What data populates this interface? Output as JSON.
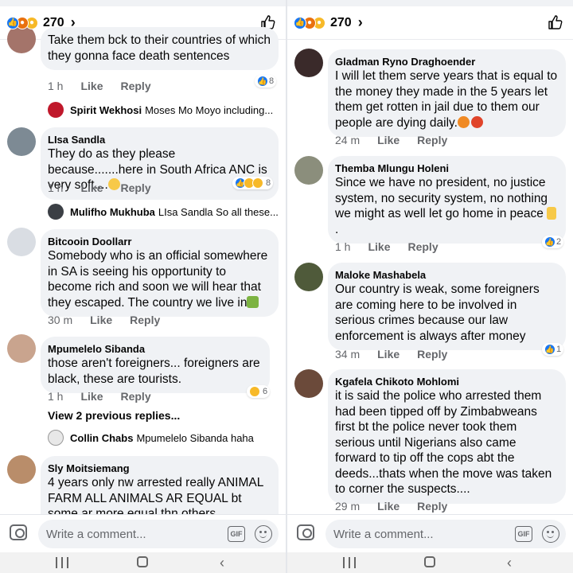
{
  "left": {
    "reaction_count": "270",
    "comments": [
      {
        "author": "",
        "text": "Take them bck to their countries of which they gonna face death sentences",
        "time": "1 h",
        "like": "Like",
        "reply": "Reply",
        "reactions": "8",
        "reply_preview": {
          "name": "Spirit Wekhosi",
          "text": "Moses Mo Moyo including..."
        }
      },
      {
        "author": "LIsa Sandla",
        "text": "They do as they please because.......here in South Africa ANC is very soft....",
        "time": "1 h",
        "like": "Like",
        "reply": "Reply",
        "reactions": "8",
        "reply_preview": {
          "name": "Mulifho Mukhuba",
          "text": "LIsa Sandla So all these..."
        }
      },
      {
        "author": "Bitcooin Doollarr",
        "text": "Somebody who is an official somewhere in SA is seeing his opportunity to become rich and soon we will hear that they escaped. The country we live in",
        "time": "30 m",
        "like": "Like",
        "reply": "Reply"
      },
      {
        "author": "Mpumelelo Sibanda",
        "text": "those aren't foreigners... foreigners are black, these are tourists.",
        "time": "1 h",
        "like": "Like",
        "reply": "Reply",
        "reactions": "6",
        "view_previous": "View 2 previous replies...",
        "reply_preview": {
          "name": "Collin Chabs",
          "text": "Mpumelelo Sibanda haha"
        }
      },
      {
        "author": "Sly Moitsiemang",
        "text": "4 years only nw arrested  really ANIMAL FARM ALL ANIMALS AR EQUAL bt some ar more equal thn others"
      }
    ],
    "composer_placeholder": "Write a comment..."
  },
  "right": {
    "reaction_count": "270",
    "comments": [
      {
        "author": "Gladman Ryno Draghoender",
        "text": "I will let them serve years that is equal to the money they made in the 5 years let them get rotten in jail due to them our people are dying daily.",
        "time": "24 m",
        "like": "Like",
        "reply": "Reply"
      },
      {
        "author": "Themba Mlungu Holeni",
        "text": "Since we have no president, no justice system, no security system, no nothing we might as well let go home in peace",
        "time": "1 h",
        "like": "Like",
        "reply": "Reply",
        "reactions": "2"
      },
      {
        "author": "Maloke Mashabela",
        "text": "Our country is weak, some foreigners are coming here to be involved in serious crimes because our law enforcement is always after money",
        "time": "34 m",
        "like": "Like",
        "reply": "Reply",
        "reactions": "1"
      },
      {
        "author": "Kgafela Chikoto Mohlomi",
        "text": "it is said the police who arrested them had been tipped off by Zimbabweans first bt the police never took them serious until  Nigerians also came forward to tip off the cops abt the deeds...thats when the move was taken to corner the suspects....",
        "time": "29 m",
        "like": "Like",
        "reply": "Reply"
      }
    ],
    "composer_placeholder": "Write a comment..."
  },
  "icons": {
    "header_reactions": [
      "like-icon",
      "angry-icon",
      "wow-icon"
    ],
    "composer": [
      "camera-icon",
      "gif-icon",
      "emoji-icon"
    ],
    "navbar": [
      "recent-apps-icon",
      "home-icon",
      "back-icon"
    ]
  },
  "colors": {
    "bubble": "#f0f2f5",
    "like_blue": "#1877f2",
    "meta_gray": "#65676b"
  }
}
